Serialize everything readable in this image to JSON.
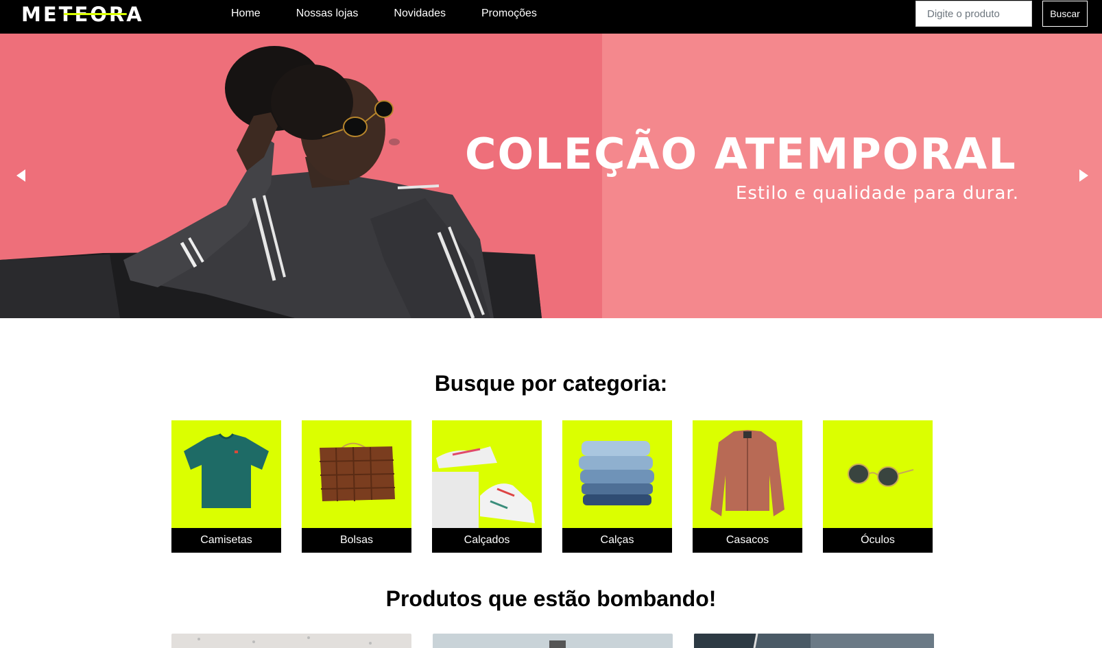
{
  "navbar": {
    "logo": "METEORA",
    "links": [
      "Home",
      "Nossas lojas",
      "Novidades",
      "Promoções"
    ],
    "search_placeholder": "Digite o produto",
    "search_button": "Buscar"
  },
  "hero": {
    "title": "COLEÇÃO ATEMPORAL",
    "subtitle": "Estilo e qualidade para durar.",
    "background_color": "#f4888d"
  },
  "categories": {
    "title": "Busque por categoria:",
    "items": [
      {
        "label": "Camisetas",
        "icon": "tshirt-image"
      },
      {
        "label": "Bolsas",
        "icon": "bag-image"
      },
      {
        "label": "Calçados",
        "icon": "sneakers-image"
      },
      {
        "label": "Calças",
        "icon": "jeans-image"
      },
      {
        "label": "Casacos",
        "icon": "jacket-image"
      },
      {
        "label": "Óculos",
        "icon": "sunglasses-image"
      }
    ],
    "card_color": "#dbff00"
  },
  "products": {
    "title": "Produtos que estão bombando!"
  },
  "colors": {
    "accent": "#dbff00",
    "navbar": "#000000"
  }
}
